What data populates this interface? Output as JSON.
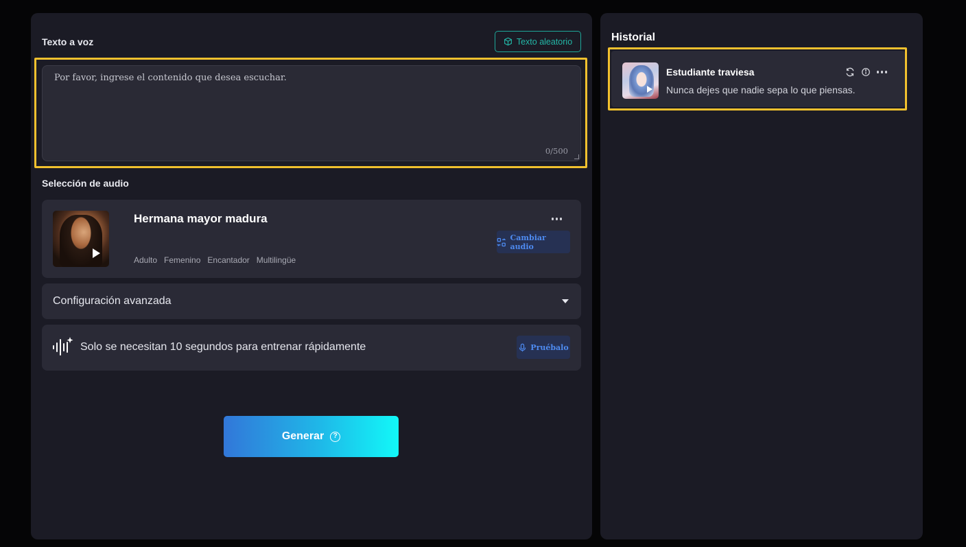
{
  "tts": {
    "section_label": "Texto a voz",
    "random_text_label": "Texto aleatorio",
    "input_placeholder": "Por favor, ingrese el contenido que desea escuchar.",
    "input_value": "",
    "char_counter": "0/500"
  },
  "audio": {
    "section_label": "Selección de audio",
    "voice_name": "Hermana mayor madura",
    "tags": [
      "Adulto",
      "Femenino",
      "Encantador",
      "Multilingüe"
    ],
    "change_label": "Cambiar audio"
  },
  "advanced": {
    "label": "Configuración avanzada"
  },
  "training": {
    "label": "Solo se necesitan 10 segundos para entrenar rápidamente",
    "try_label": "Pruébalo"
  },
  "generate": {
    "label": "Generar"
  },
  "history": {
    "title": "Historial",
    "items": [
      {
        "voice_name": "Estudiante traviesa",
        "text": "Nunca dejes que nadie sepa lo que piensas."
      }
    ]
  },
  "colors": {
    "highlight": "#f2c12e",
    "accent_teal": "#23b7a7",
    "accent_blue": "#4e8bf1",
    "generate_gradient_start": "#3277d9",
    "generate_gradient_end": "#12f8f8"
  },
  "icons": {
    "random_text": "cube-icon",
    "change_audio": "swap-grid-icon",
    "training": "voice-wave-icon",
    "try": "mic-icon",
    "generate_help": "help-icon",
    "history_regenerate": "refresh-icon",
    "history_info": "info-icon",
    "history_more": "more-icon"
  }
}
